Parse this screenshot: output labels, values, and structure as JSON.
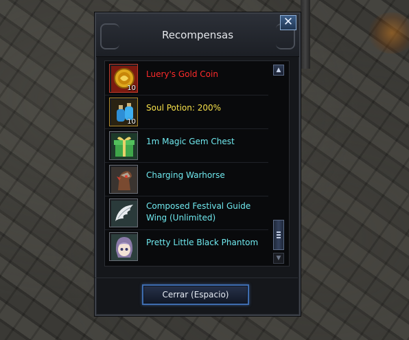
{
  "window": {
    "title": "Recompensas",
    "close_icon": "close-icon"
  },
  "rewards": [
    {
      "name": "Luery's Gold Coin",
      "quantity": "10",
      "color": "#ff2b2b",
      "icon": "gold-coin-icon"
    },
    {
      "name": "Soul Potion: 200%",
      "quantity": "10",
      "color": "#f5e04a",
      "icon": "potion-icon"
    },
    {
      "name": "1m Magic Gem Chest",
      "quantity": "",
      "color": "#6fe8ee",
      "icon": "gift-box-icon"
    },
    {
      "name": "Charging Warhorse",
      "quantity": "",
      "color": "#6fe8ee",
      "icon": "warhorse-icon"
    },
    {
      "name": "Composed Festival Guide Wing (Unlimited)",
      "quantity": "",
      "color": "#6fe8ee",
      "icon": "wing-icon"
    },
    {
      "name": "Pretty Little Black Phantom",
      "quantity": "",
      "color": "#6fe8ee",
      "icon": "phantom-doll-icon"
    }
  ],
  "scroll": {
    "up_icon": "scroll-up-icon",
    "down_icon": "scroll-down-icon",
    "position": 1.0
  },
  "footer": {
    "close_label": "Cerrar (Espacio)"
  }
}
